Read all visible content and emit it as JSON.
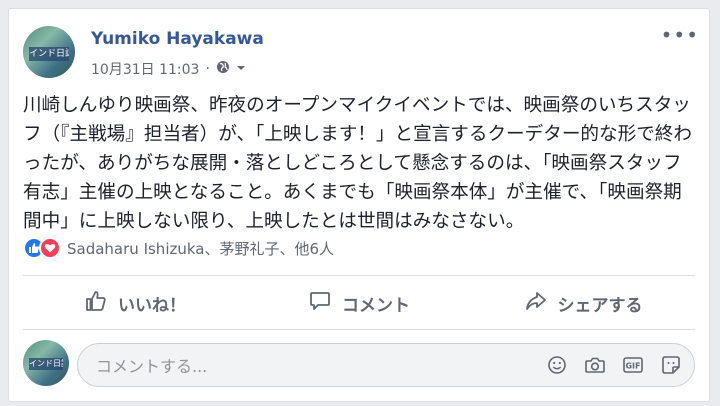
{
  "post": {
    "author": "Yumiko Hayakawa",
    "timestamp": "10月31日 11:03",
    "meta_separator": "·",
    "body": "川崎しんゆり映画祭、昨夜のオープンマイクイベントでは、映画祭のいちスタッフ（『主戦場』担当者）が、「上映します！」と宣言するクーデター的な形で終わったが、ありがちな展開・落としどころとして懸念するのは、「映画祭スタッフ有志」主催の上映となること。あくまでも「映画祭本体」が主催で、「映画祭期間中」に上映しない限り、上映したとは世間はみなさない。",
    "more_menu": "•••",
    "avatar_text": "インド日誌"
  },
  "reactions": {
    "names": "Sadaharu Ishizuka、茅野礼子、他6人",
    "types": [
      "like",
      "love"
    ]
  },
  "actions": {
    "like_label": "いいね！",
    "comment_label": "コメント",
    "share_label": "シェアする"
  },
  "comment_box": {
    "placeholder": "コメントする...",
    "icons": [
      "emoji-icon",
      "camera-icon",
      "gif-icon",
      "sticker-icon"
    ],
    "gif_text": "GIF"
  },
  "colors": {
    "author": "#365899",
    "like": "#2078f4",
    "love": "#f33e58",
    "muted": "#606770"
  }
}
